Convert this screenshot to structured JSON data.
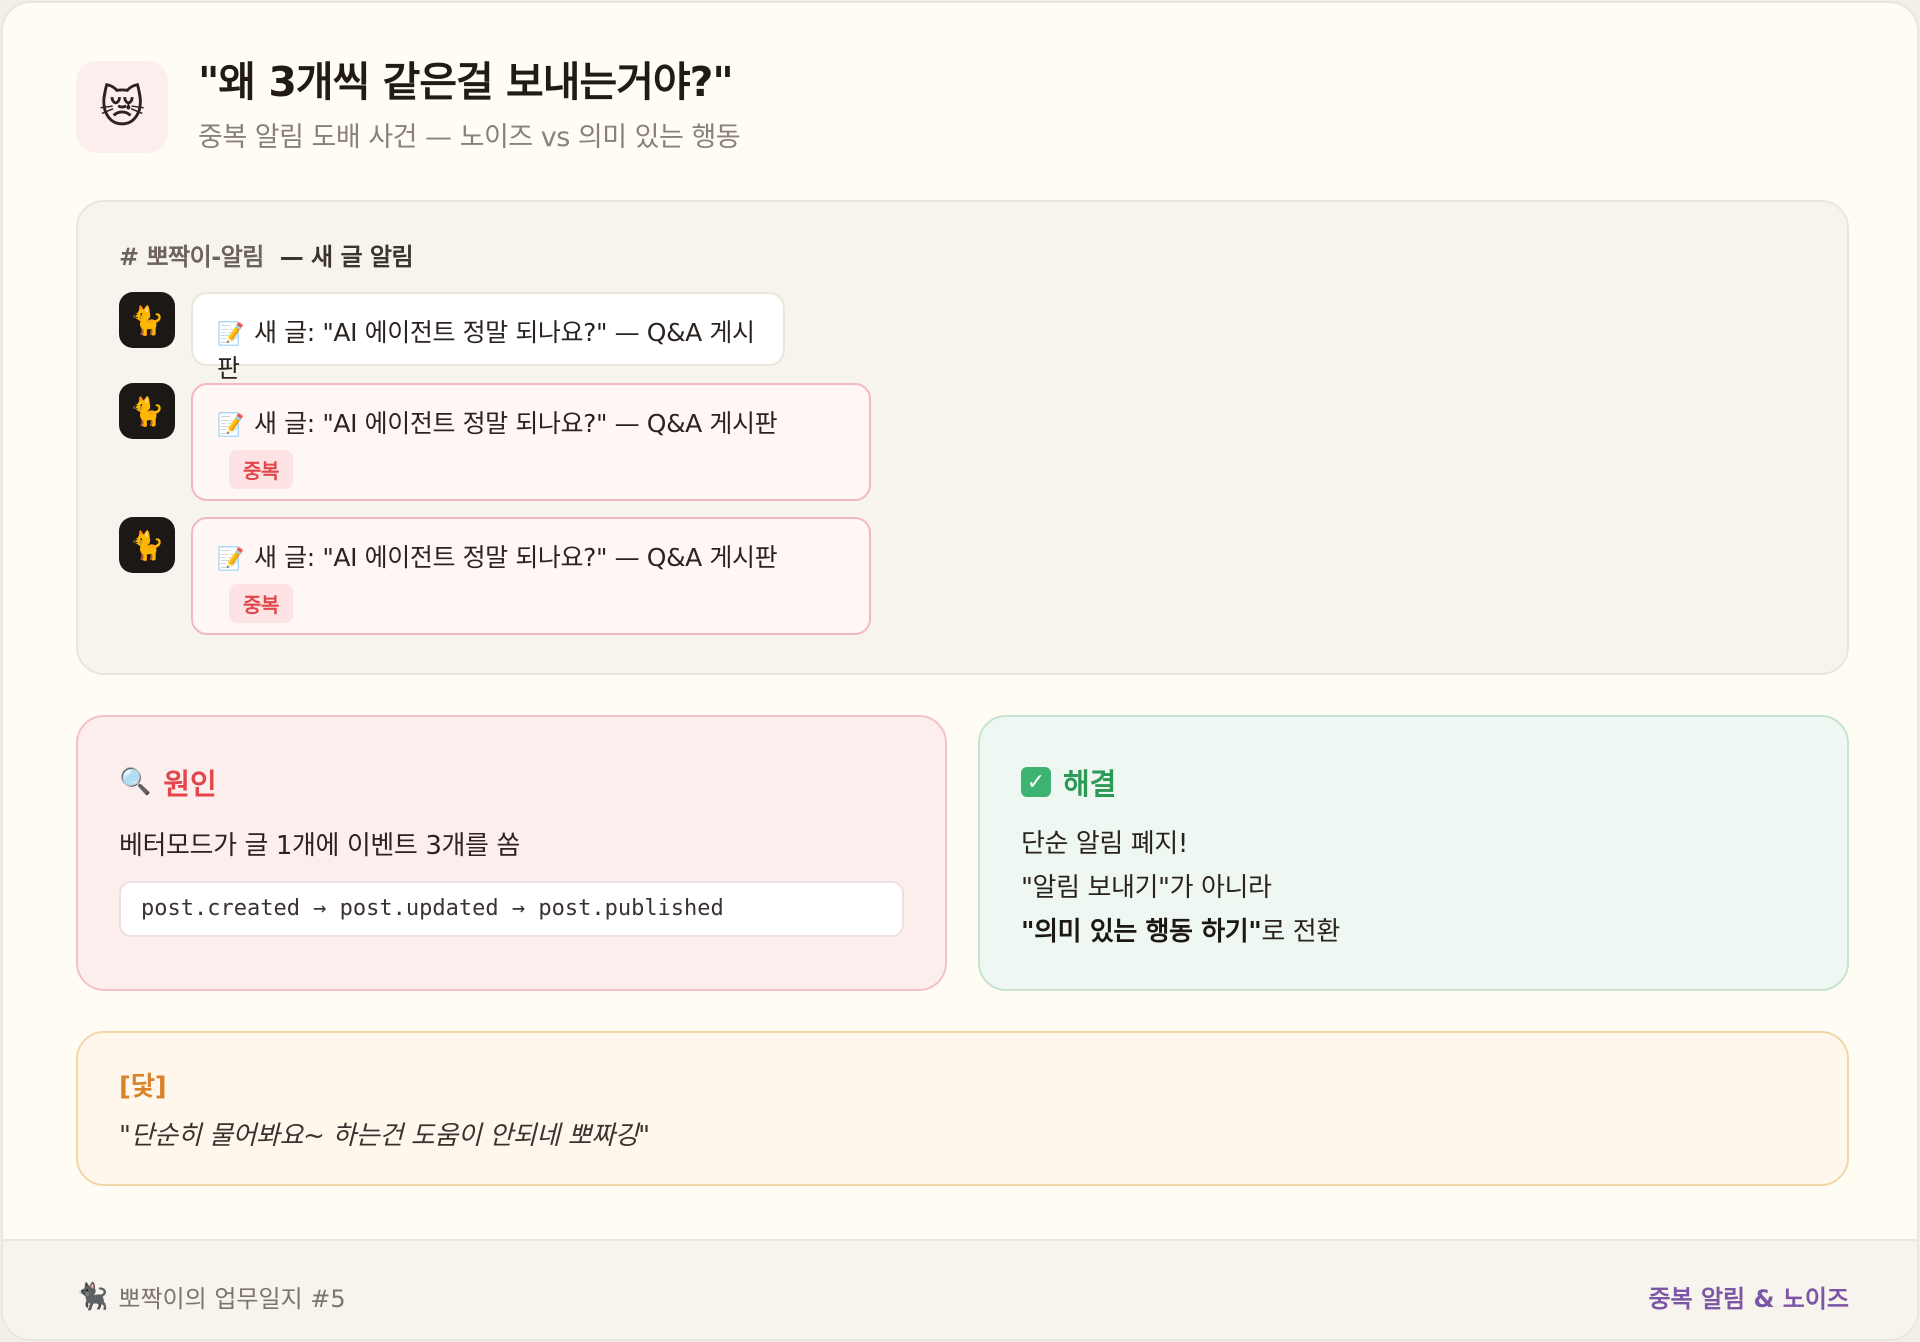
{
  "header": {
    "icon": "crying-cat-icon",
    "icon_glyph": "😿",
    "title": "\"왜 3개씩 같은걸 보내는거야?\"",
    "subtitle": "중복 알림 도배 사건 — 노이즈 vs 의미 있는 행동"
  },
  "channel": {
    "name": "# 뽀짝이-알림",
    "description": "— 새 글 알림",
    "avatar_icon": "black-cat-icon",
    "avatar_glyph": "🐈",
    "messages": [
      {
        "pen_glyph": "📝",
        "text": "새 글: \"AI 에이전트 정말 되나요?\" — Q&A 게시판",
        "badge": ""
      },
      {
        "pen_glyph": "📝",
        "text": "새 글: \"AI 에이전트 정말 되나요?\" — Q&A 게시판",
        "badge": "중복"
      },
      {
        "pen_glyph": "📝",
        "text": "새 글: \"AI 에이전트 정말 되나요?\" — Q&A 게시판",
        "badge": "중복"
      }
    ]
  },
  "cause": {
    "icon": "magnifier-icon",
    "icon_glyph": "🔍",
    "title": "원인",
    "text": "베터모드가 글 1개에 이벤트 3개를 쏨",
    "code": "post.created → post.updated → post.published"
  },
  "solution": {
    "icon": "check-box-icon",
    "icon_glyph": "✓",
    "title": "해결",
    "line1": "단순 알림 폐지!",
    "line2": "\"알림 보내기\"가 아니라",
    "line3_bold": "\"의미 있는 행동 하기\"",
    "line3_rest": "로 전환"
  },
  "quote": {
    "tag": "[닻]",
    "text": "\"단순히 물어봐요~ 하는건 도움이 안되네 뽀짜깅\""
  },
  "footer": {
    "cat_glyph": "🐈‍⬛",
    "left": "뽀짝이의 업무일지 #5",
    "right": "중복 알림 & 노이즈"
  },
  "colors": {
    "accent_red": "#e2454a",
    "accent_green": "#2c9a57",
    "accent_orange": "#d8822a",
    "accent_purple": "#7c55a6"
  }
}
